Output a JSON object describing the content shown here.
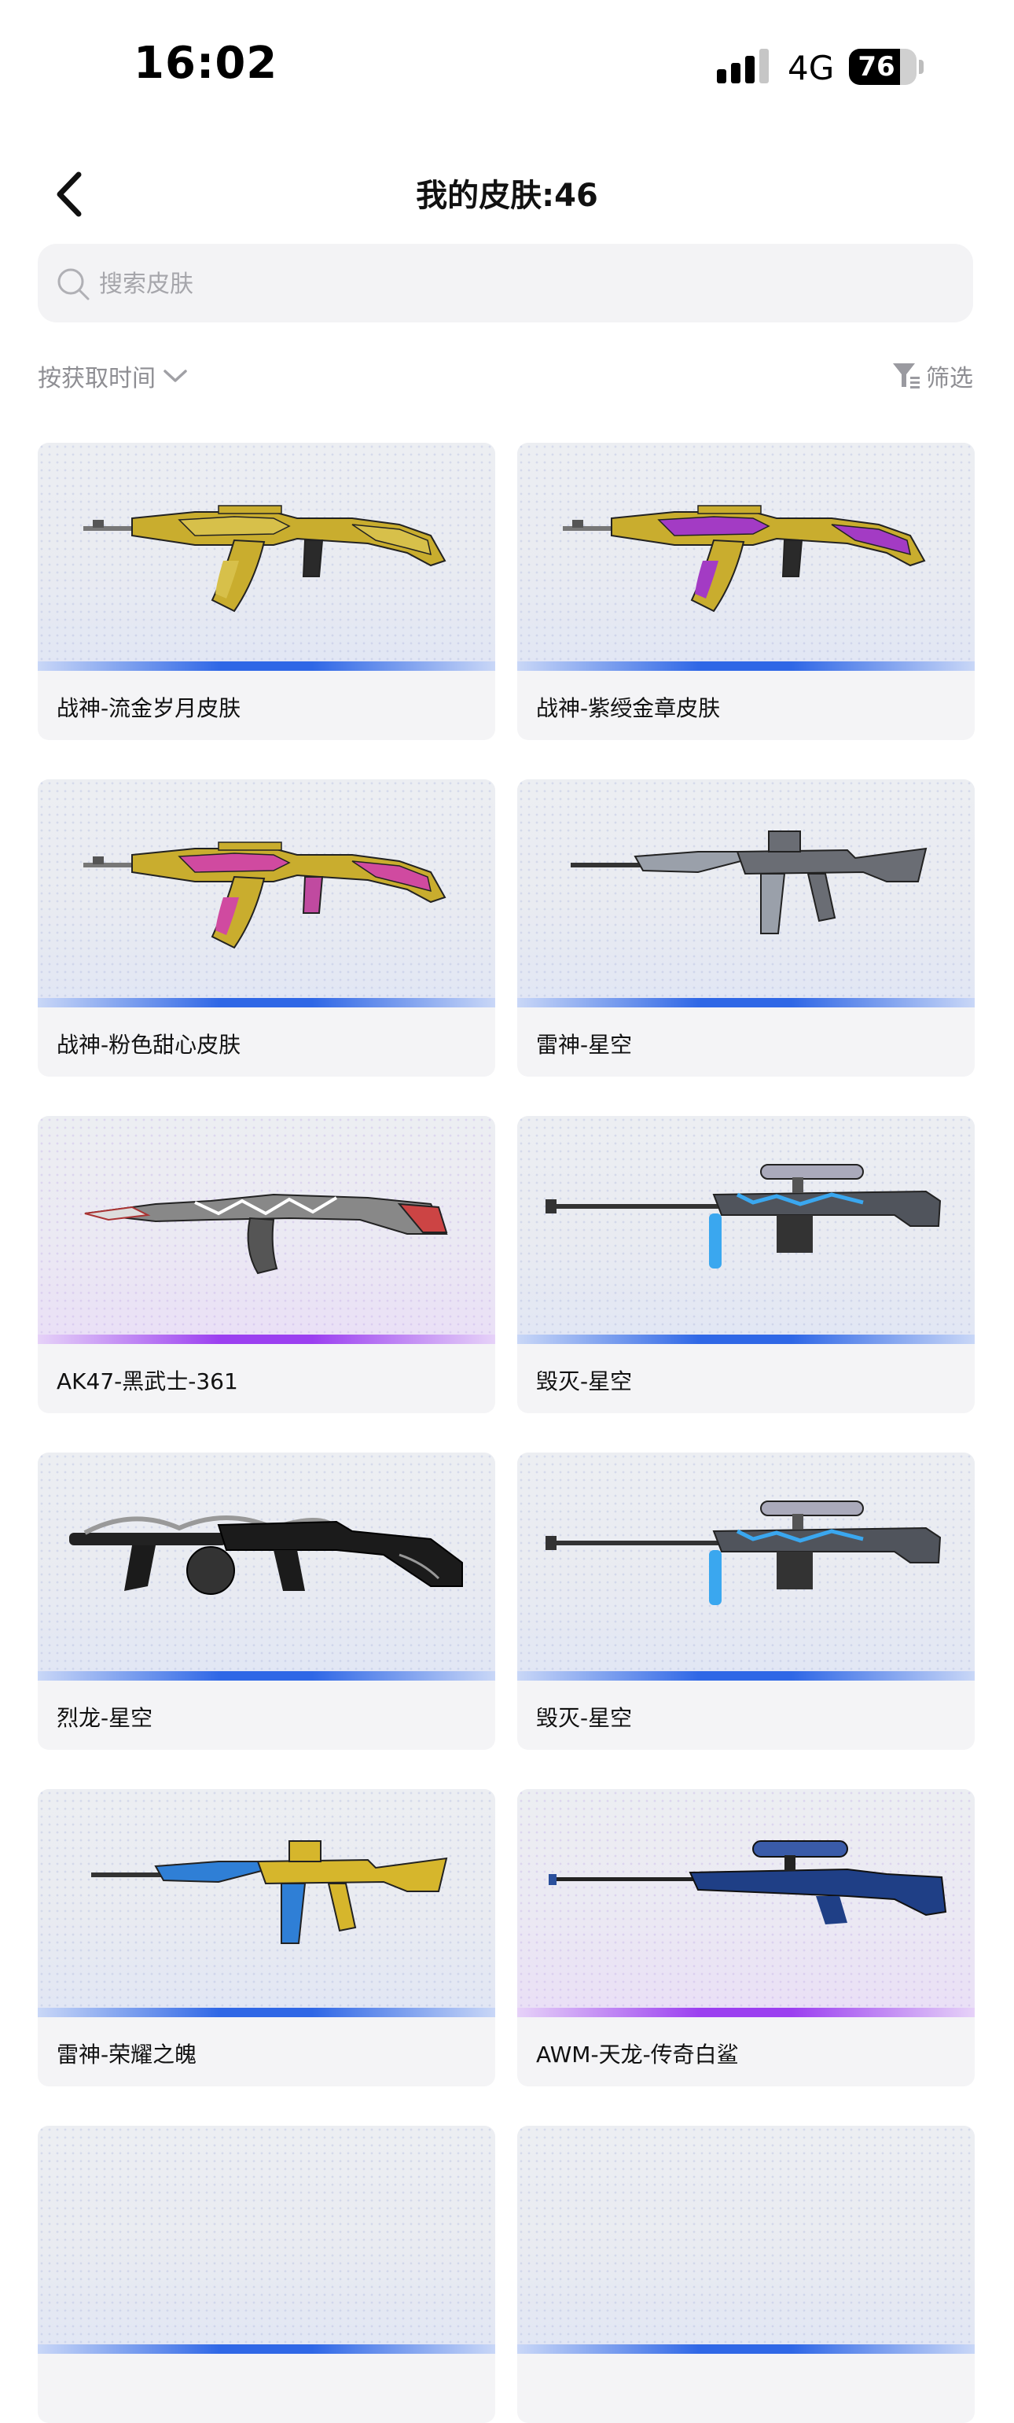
{
  "status_bar": {
    "time": "16:02",
    "network": "4G",
    "battery_level": "76",
    "battery_fraction": 0.76
  },
  "header": {
    "title": "我的皮肤:46"
  },
  "search": {
    "placeholder": "搜索皮肤"
  },
  "sort": {
    "label": "按获取时间"
  },
  "filter": {
    "label": "筛选"
  },
  "colors": {
    "rarity_blue": "#2f67e6",
    "rarity_purple": "#9b3ff0"
  },
  "skins": [
    {
      "name": "战神-流金岁月皮肤",
      "rarity": "blue",
      "icon": "ak-gold-icon"
    },
    {
      "name": "战神-紫绶金章皮肤",
      "rarity": "blue",
      "icon": "ak-purple-gold-icon"
    },
    {
      "name": "战神-粉色甜心皮肤",
      "rarity": "blue",
      "icon": "ak-pink-gold-icon"
    },
    {
      "name": "雷神-星空",
      "rarity": "blue",
      "icon": "m4-starry-icon"
    },
    {
      "name": "AK47-黑武士-361",
      "rarity": "purple",
      "icon": "ak47-black-warrior-icon"
    },
    {
      "name": "毁灭-星空",
      "rarity": "blue",
      "icon": "sniper-starry-icon"
    },
    {
      "name": "烈龙-星空",
      "rarity": "blue",
      "icon": "tommy-dragon-icon"
    },
    {
      "name": "毁灭-星空",
      "rarity": "blue",
      "icon": "sniper-starry-icon"
    },
    {
      "name": "雷神-荣耀之魄",
      "rarity": "blue",
      "icon": "m4-glory-icon"
    },
    {
      "name": "AWM-天龙-传奇白鲨",
      "rarity": "purple",
      "icon": "awm-shark-icon"
    },
    {
      "name": "",
      "rarity": "blue",
      "icon": ""
    },
    {
      "name": "",
      "rarity": "blue",
      "icon": ""
    }
  ]
}
